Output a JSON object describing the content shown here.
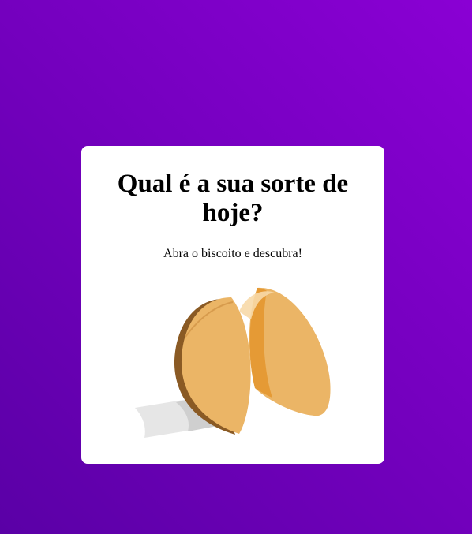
{
  "card": {
    "title": "Qual é a sua sorte de hoje?",
    "subtitle": "Abra o biscoito e descubra!"
  },
  "cookie": {
    "icon": "fortune-cookie-icon",
    "colors": {
      "dough": "#ebb566",
      "dough_dark": "#e59a35",
      "dough_shadow": "#8a5a24",
      "highlight": "#f7d9a8",
      "paper": "#e6e6e6",
      "paper_shade": "#cfcfcf"
    }
  },
  "colors": {
    "background_start": "#5a00a6",
    "background_end": "#8a00d4",
    "card": "#ffffff"
  }
}
